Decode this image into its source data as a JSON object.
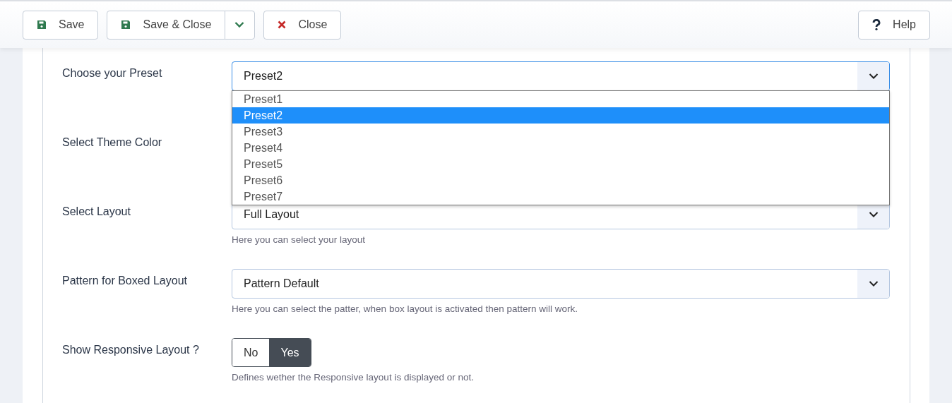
{
  "toolbar": {
    "buttons": [
      {
        "kind": "save",
        "label": "Save"
      },
      {
        "kind": "split",
        "label": "Save & Close"
      },
      {
        "kind": "close",
        "label": "Close"
      }
    ],
    "help": {
      "label": "Help"
    }
  },
  "rows": [
    {
      "kind": "select",
      "label": "Choose your Preset",
      "value": "Preset2",
      "open": true,
      "options": [
        {
          "label": "Preset1",
          "selected": false
        },
        {
          "label": "Preset2",
          "selected": true
        },
        {
          "label": "Preset3",
          "selected": false
        },
        {
          "label": "Preset4",
          "selected": false
        },
        {
          "label": "Preset5",
          "selected": false
        },
        {
          "label": "Preset6",
          "selected": false
        },
        {
          "label": "Preset7",
          "selected": false
        }
      ]
    },
    {
      "kind": "covered",
      "label": "Select Theme Color"
    },
    {
      "kind": "select",
      "label": "Select Layout",
      "value": "Full Layout",
      "open": false,
      "help": "Here you can select your layout"
    },
    {
      "kind": "select",
      "label": "Pattern for Boxed Layout",
      "value": "Pattern Default",
      "open": false,
      "help": "Here you can select the patter, when box layout is activated then pattern will work."
    },
    {
      "kind": "toggle",
      "label": "Show Responsive Layout ?",
      "options": [
        {
          "label": "No",
          "selected": false
        },
        {
          "label": "Yes",
          "selected": true
        }
      ],
      "help": "Defines wether the Responsive layout is displayed or not."
    }
  ]
}
